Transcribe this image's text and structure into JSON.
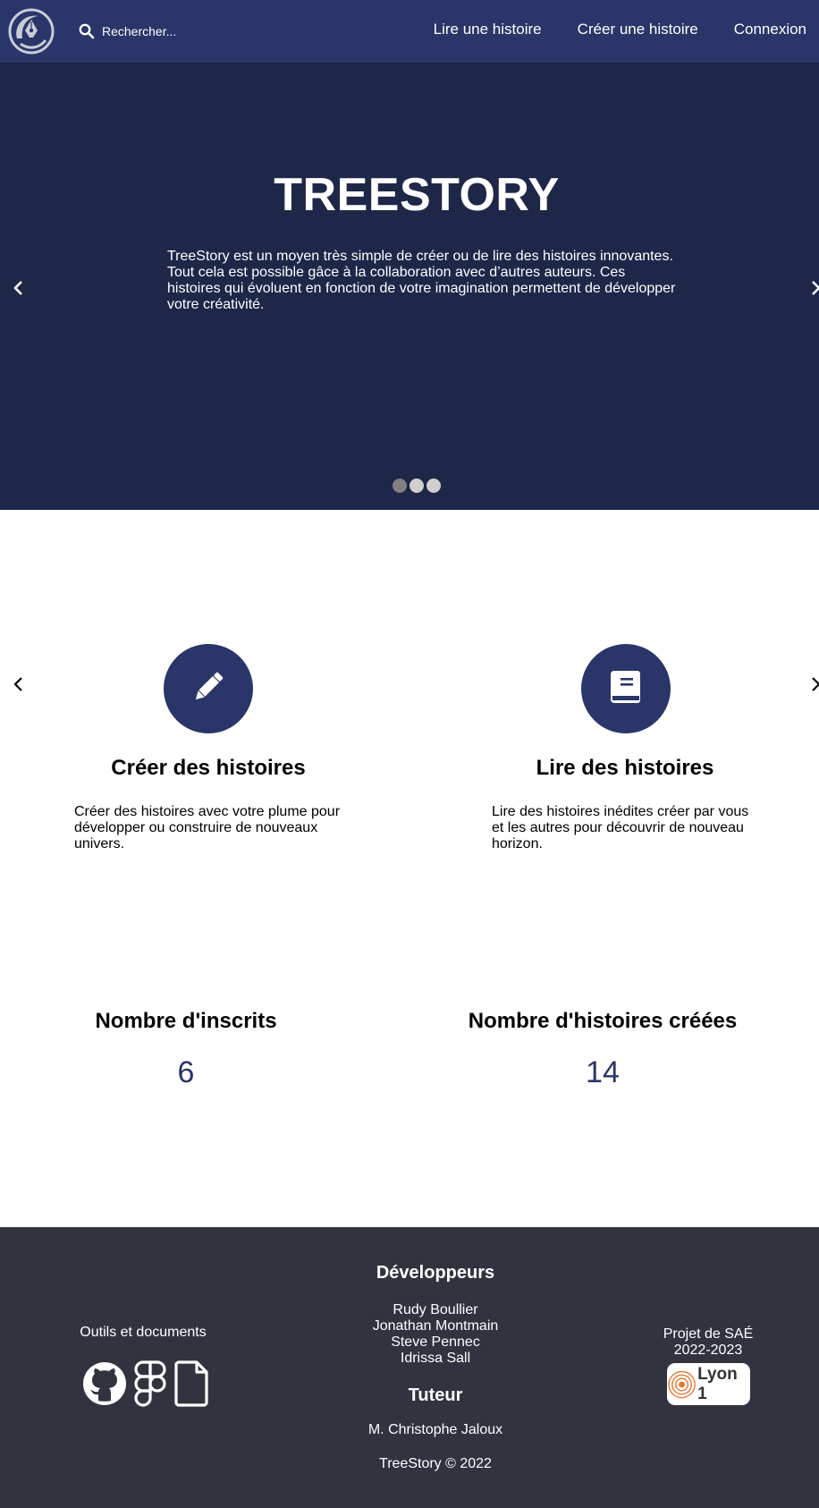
{
  "nav": {
    "search_placeholder": "Rechercher...",
    "links": [
      "Lire une histoire",
      "Créer une histoire",
      "Connexion"
    ]
  },
  "hero": {
    "title": "TREESTORY",
    "text": "TreeStory est un moyen très simple de créer ou de lire des histoires innovantes. Tout cela est possible gâce à la collaboration avec d’autres auteurs. Ces histoires qui évoluent en fonction de votre imagination permettent de développer votre créativité.",
    "slide_count": 3,
    "active_slide": 1
  },
  "features": [
    {
      "icon": "pencil-icon",
      "title": "Créer des histoires",
      "description": "Créer des histoires avec votre plume pour développer ou construire de nouveaux univers."
    },
    {
      "icon": "book-icon",
      "title": "Lire des histoires",
      "description": "Lire des histoires inédites créer par vous et les autres pour découvrir de nouveau horizon."
    }
  ],
  "stats": [
    {
      "label": "Nombre d'inscrits",
      "value": "6"
    },
    {
      "label": "Nombre d'histoires créées",
      "value": "14"
    }
  ],
  "footer": {
    "tools_label": "Outils et documents",
    "tools_icons": [
      "github-icon",
      "figma-icon",
      "document-icon"
    ],
    "developers_heading": "Développeurs",
    "developers": [
      "Rudy Boullier",
      "Jonathan Montmain",
      "Steve Pennec",
      "Idrissa Sall"
    ],
    "tutor_heading": "Tuteur",
    "tutor": "M. Christophe Jaloux",
    "project_line1": "Projet de SAÉ",
    "project_line2": "2022-2023",
    "lyon_logo_text": "Lyon 1",
    "copyright": "TreeStory © 2022"
  },
  "colors": {
    "nav_bg": "#2a3569",
    "hero_bg": "#1f2749",
    "accent": "#2a3569",
    "footer_bg": "#31343f"
  }
}
